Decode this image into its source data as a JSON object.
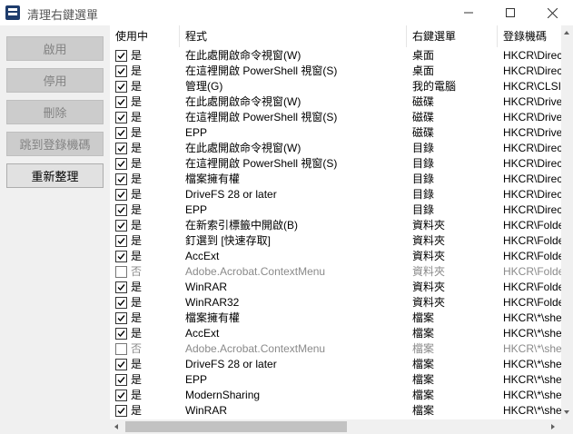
{
  "window": {
    "title": "清理右鍵選單",
    "minimize_icon": "minimize-icon",
    "maximize_icon": "maximize-icon",
    "close_icon": "close-icon"
  },
  "sidebar": {
    "buttons": [
      {
        "label": "啟用",
        "enabled": false
      },
      {
        "label": "停用",
        "enabled": false
      },
      {
        "label": "刪除",
        "enabled": false
      },
      {
        "label": "跳到登錄機碼",
        "enabled": false
      },
      {
        "label": "重新整理",
        "enabled": true
      }
    ]
  },
  "list": {
    "columns": [
      "使用中",
      "程式",
      "右鍵選單",
      "登錄機碼"
    ],
    "rows": [
      {
        "checked": true,
        "status": "是",
        "program": "在此處開啟命令視窗(W)",
        "menu": "桌面",
        "key": "HKCR\\Directo"
      },
      {
        "checked": true,
        "status": "是",
        "program": "在這裡開啟 PowerShell 視窗(S)",
        "menu": "桌面",
        "key": "HKCR\\Directo"
      },
      {
        "checked": true,
        "status": "是",
        "program": "管理(G)",
        "menu": "我的電腦",
        "key": "HKCR\\CLSID"
      },
      {
        "checked": true,
        "status": "是",
        "program": "在此處開啟命令視窗(W)",
        "menu": "磁碟",
        "key": "HKCR\\Drive\\"
      },
      {
        "checked": true,
        "status": "是",
        "program": "在這裡開啟 PowerShell 視窗(S)",
        "menu": "磁碟",
        "key": "HKCR\\Drive\\"
      },
      {
        "checked": true,
        "status": "是",
        "program": "EPP",
        "menu": "磁碟",
        "key": "HKCR\\Drive\\"
      },
      {
        "checked": true,
        "status": "是",
        "program": "在此處開啟命令視窗(W)",
        "menu": "目錄",
        "key": "HKCR\\Directo"
      },
      {
        "checked": true,
        "status": "是",
        "program": "在這裡開啟 PowerShell 視窗(S)",
        "menu": "目錄",
        "key": "HKCR\\Directo"
      },
      {
        "checked": true,
        "status": "是",
        "program": "檔案擁有權",
        "menu": "目錄",
        "key": "HKCR\\Directo"
      },
      {
        "checked": true,
        "status": "是",
        "program": "DriveFS 28 or later",
        "menu": "目錄",
        "key": "HKCR\\Directo"
      },
      {
        "checked": true,
        "status": "是",
        "program": "EPP",
        "menu": "目錄",
        "key": "HKCR\\Directo"
      },
      {
        "checked": true,
        "status": "是",
        "program": "在新索引標籤中開啟(B)",
        "menu": "資料夾",
        "key": "HKCR\\Folder"
      },
      {
        "checked": true,
        "status": "是",
        "program": "釘選到 [快速存取]",
        "menu": "資料夾",
        "key": "HKCR\\Folder"
      },
      {
        "checked": true,
        "status": "是",
        "program": "AccExt",
        "menu": "資料夾",
        "key": "HKCR\\Folder"
      },
      {
        "checked": false,
        "status": "否",
        "program": "Adobe.Acrobat.ContextMenu",
        "menu": "資料夾",
        "key": "HKCR\\Folder"
      },
      {
        "checked": true,
        "status": "是",
        "program": "WinRAR",
        "menu": "資料夾",
        "key": "HKCR\\Folder"
      },
      {
        "checked": true,
        "status": "是",
        "program": "WinRAR32",
        "menu": "資料夾",
        "key": "HKCR\\Folder"
      },
      {
        "checked": true,
        "status": "是",
        "program": "檔案擁有權",
        "menu": "檔案",
        "key": "HKCR\\*\\shel"
      },
      {
        "checked": true,
        "status": "是",
        "program": "AccExt",
        "menu": "檔案",
        "key": "HKCR\\*\\shel"
      },
      {
        "checked": false,
        "status": "否",
        "program": "Adobe.Acrobat.ContextMenu",
        "menu": "檔案",
        "key": "HKCR\\*\\shel"
      },
      {
        "checked": true,
        "status": "是",
        "program": "DriveFS 28 or later",
        "menu": "檔案",
        "key": "HKCR\\*\\shel"
      },
      {
        "checked": true,
        "status": "是",
        "program": "EPP",
        "menu": "檔案",
        "key": "HKCR\\*\\shel"
      },
      {
        "checked": true,
        "status": "是",
        "program": "ModernSharing",
        "menu": "檔案",
        "key": "HKCR\\*\\shel"
      },
      {
        "checked": true,
        "status": "是",
        "program": "WinRAR",
        "menu": "檔案",
        "key": "HKCR\\*\\shel"
      }
    ]
  },
  "colors": {
    "accent": "#1e3c6c",
    "disabled_text": "#8a8a8a"
  }
}
